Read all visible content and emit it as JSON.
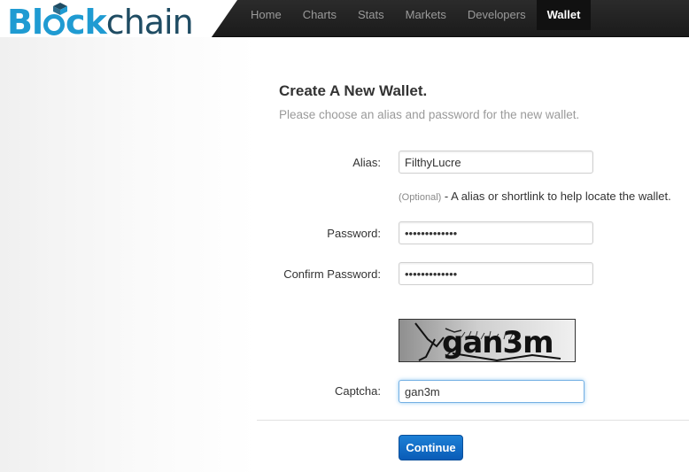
{
  "header": {
    "logo_part1": "Bl",
    "logo_part2": "ck",
    "logo_part3": "chain",
    "nav": [
      {
        "label": "Home"
      },
      {
        "label": "Charts"
      },
      {
        "label": "Stats"
      },
      {
        "label": "Markets"
      },
      {
        "label": "Developers"
      },
      {
        "label": "Wallet",
        "active": true
      }
    ]
  },
  "form": {
    "title": "Create A New Wallet.",
    "subtitle": "Please choose an alias and password for the new wallet.",
    "alias": {
      "label": "Alias:",
      "value": "FilthyLucre"
    },
    "alias_help": {
      "optional": "(Optional)",
      "text": " - A alias or shortlink to help locate the wallet."
    },
    "password": {
      "label": "Password:",
      "value": "•••••••••••••"
    },
    "confirm_password": {
      "label": "Confirm Password:",
      "value": "•••••••••••••"
    },
    "captcha_image_text": "gan3m",
    "captcha": {
      "label": "Captcha:",
      "value": "gan3m"
    },
    "submit_label": "Continue"
  },
  "colors": {
    "brand_blue": "#1f9bd2",
    "brand_dark": "#1f4c63",
    "button_blue": "#0a5cb7"
  }
}
